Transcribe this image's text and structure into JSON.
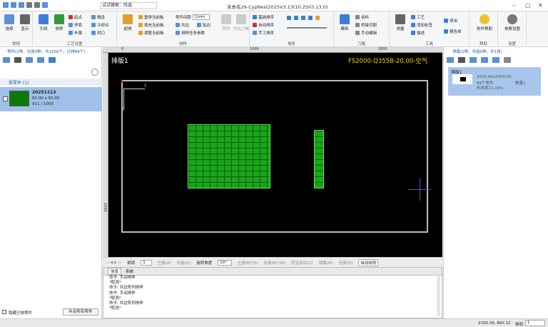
{
  "titlebar": {
    "search": "试试搜索：阵选",
    "title": "未命名29-CypNest2025V3.13(10.2503.13.0)"
  },
  "ribbon": {
    "g1": {
      "label": "常规",
      "b1": "选择",
      "b2": "显示"
    },
    "g2": {
      "label": "工艺设置",
      "b1": "引线",
      "b2": "侧移",
      "s1": "起点",
      "s2": "停靠",
      "s3": "补偿",
      "s4": "微连",
      "s5": "冷却点",
      "s6": "封口"
    },
    "g3": {
      "label": "排样",
      "b1": "超排",
      "s1": "重排当前板",
      "s2": "填充当前板",
      "s3": "调整当前板",
      "s4": "零件间距",
      "s5": "共边",
      "s6": "贴边",
      "s7": "排样任务参数",
      "spacing": "1mm",
      "b2": "阵列",
      "b3": "共边刀具"
    },
    "g4": {
      "label": "排序",
      "s1": "基础排序",
      "s2": "自动排序",
      "s3": "手工排序"
    },
    "g5": {
      "label": "刀路",
      "b1": "模拟",
      "s1": "余料",
      "s2": "桥接切割",
      "s3": "手动编辑"
    },
    "g6": {
      "label": "工具",
      "b1": "测量",
      "s1": "工艺",
      "s2": "添加标签",
      "s3": "描述",
      "s4": "导出",
      "s5": "报告单"
    },
    "g7": {
      "label": "帮助",
      "b1": "软件帮助"
    },
    "g8": {
      "label": "设置",
      "b1": "参数设置"
    }
  },
  "left": {
    "header": "零件(1种，勾选0种，共1000个，已排89个)",
    "section": "单零件  (1)",
    "part": {
      "name": "20251113",
      "size": "80.00 x 50.00",
      "count": "911 / 1000"
    },
    "hide_label": "隐藏已排零件",
    "btn": "补足所有零件"
  },
  "canvas": {
    "sheet_label": "排版1",
    "material": "FS2000-Q355B-20.00-空气",
    "ruler_ticks": [
      "0",
      "1000",
      "2000"
    ],
    "vruler": [
      "1000"
    ],
    "axis_x": "X",
    "axis_y": "Y"
  },
  "canvastool": {
    "rotate": "倒调",
    "rotate_val": "1",
    "left": "左旋(A)",
    "right": "右旋(D)",
    "angle_label": "旋转角度",
    "angle": "10°",
    "l90": "左旋90°(S)",
    "r90": "右旋90°(W)",
    "target": "转至靠目(Q)",
    "mirror": "镜像(M)",
    "back": "还原(O)",
    "auto": "自动吸附"
  },
  "output": {
    "tab1": "信息",
    "tab2": "系统",
    "lines": [
      "命令: 手动排样",
      "*取消*",
      "命令: 共边阵列排样",
      "命令: 手动排样",
      "*取消*",
      "命令: 共边阵列排样",
      "*取消*"
    ]
  },
  "right": {
    "header": "排版(1种，勾选0种，共1张)",
    "sheet": {
      "name": "排版1",
      "size": "2000.00x2400.00",
      "parts": "89个零件",
      "qty": "数量1",
      "util": "利用率11.39%"
    }
  },
  "status": {
    "coords": "2330.39, 860.32",
    "mode": "倒调",
    "val": "1"
  }
}
